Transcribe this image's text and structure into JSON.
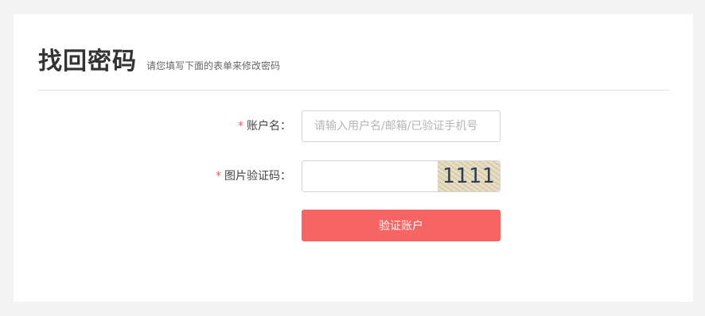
{
  "header": {
    "title": "找回密码",
    "subtitle": "请您填写下面的表单来修改密码"
  },
  "form": {
    "required_mark": "*",
    "account": {
      "label": "账户名：",
      "value": "",
      "placeholder": "请输入用户名/邮箱/已验证手机号"
    },
    "captcha": {
      "label": "图片验证码：",
      "value": "",
      "placeholder": "",
      "image_text": "1111"
    },
    "submit_label": "验证账户"
  },
  "colors": {
    "accent": "#f66464",
    "required": "#f26364",
    "background": "#f3f3f3"
  }
}
